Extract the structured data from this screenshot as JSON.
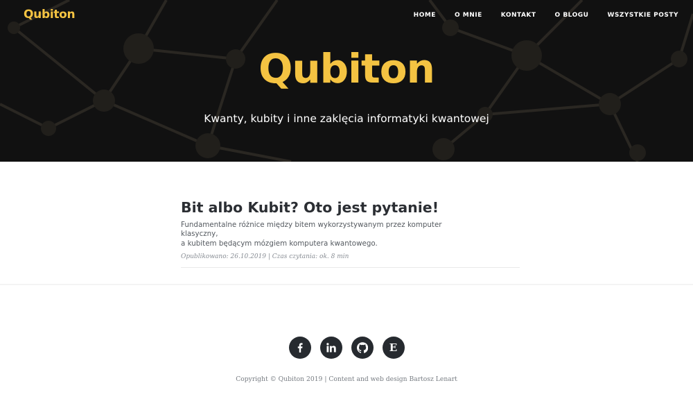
{
  "nav": {
    "logo": "Qubiton",
    "items": [
      {
        "label": "HOME"
      },
      {
        "label": "O MNIE"
      },
      {
        "label": "KONTAKT"
      },
      {
        "label": "O BLOGU"
      },
      {
        "label": "WSZYSTKIE POSTY"
      }
    ]
  },
  "hero": {
    "title": "Qubiton",
    "subtitle": "Kwanty, kubity i inne zaklęcia informatyki kwantowej"
  },
  "post": {
    "title": "Bit albo Kubit? Oto jest pytanie!",
    "excerpt_line1": "Fundamentalne różnice między bitem wykorzystywanym przez komputer klasyczny,",
    "excerpt_line2": "a kubitem będącym mózgiem komputera kwantowego.",
    "meta": "Opublikowano: 26.10.2019 | Czas czytania: ok. 8 min"
  },
  "social": [
    {
      "icon": "facebook-icon"
    },
    {
      "icon": "linkedin-icon"
    },
    {
      "icon": "github-icon"
    },
    {
      "icon": "medium-icon",
      "glyph": "E"
    }
  ],
  "footer": {
    "copyright": "Copyright © Qubiton 2019 | Content and web design Bartosz Lenart"
  },
  "colors": {
    "accent": "#f4c342",
    "hero_bg": "#111111",
    "icon_bg": "#262a2f"
  }
}
